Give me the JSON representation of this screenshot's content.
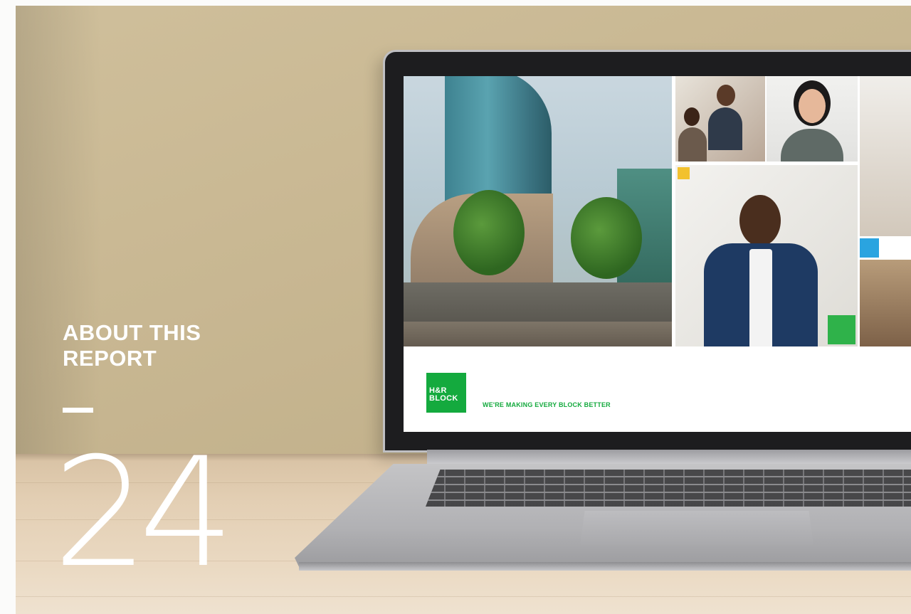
{
  "section": {
    "heading": "ABOUT THIS REPORT",
    "page_number": "24"
  },
  "laptop_screen": {
    "logo_line1": "H&R",
    "logo_line2": "BLOCK",
    "tagline": "WE'RE MAKING EVERY BLOCK BETTER"
  },
  "colors": {
    "brand_green": "#14aa3e",
    "accent_yellow": "#f2c12e",
    "accent_blue": "#2aa4e0"
  }
}
